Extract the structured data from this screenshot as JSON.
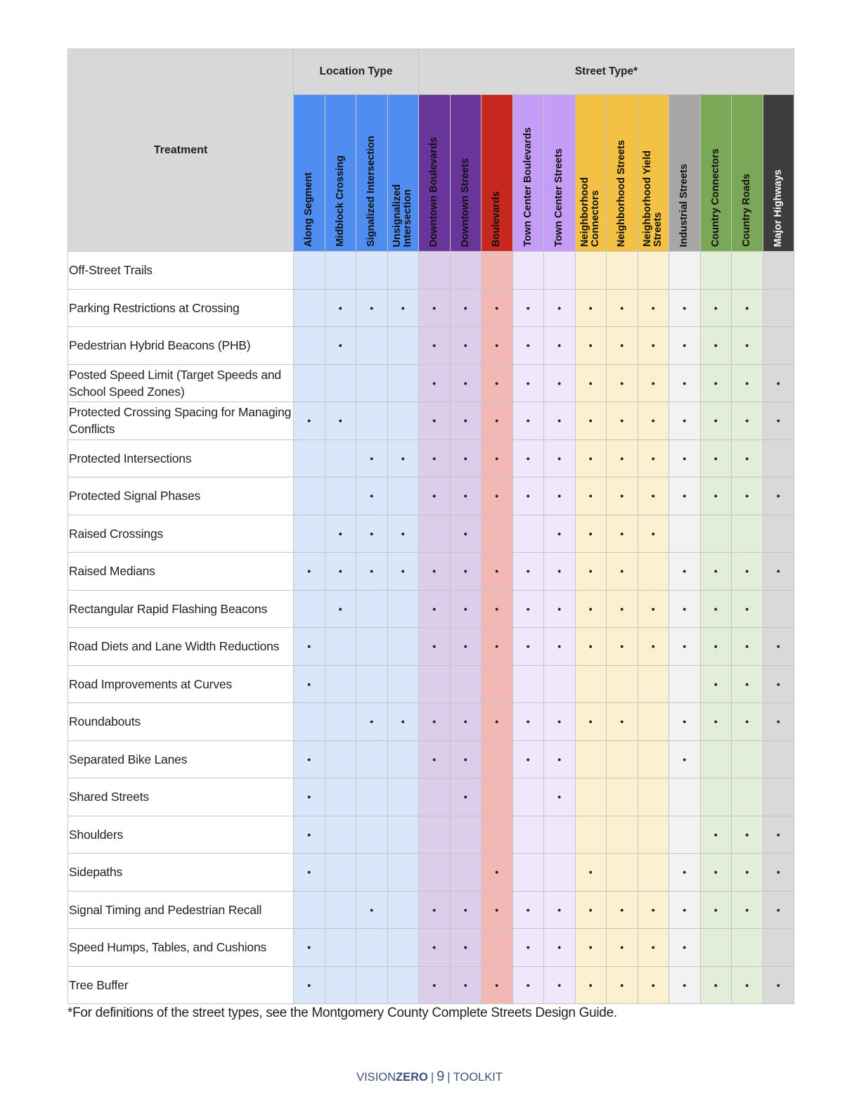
{
  "table": {
    "corner_label": "Treatment",
    "groups": [
      {
        "label": "Location Type",
        "span": 4
      },
      {
        "label": "Street Type*",
        "span": 12
      }
    ],
    "columns": [
      {
        "label": "Along Segment",
        "header_color": "#4f8ef0",
        "cell_color": "#d9e7fa",
        "text_color": "#111111"
      },
      {
        "label": "Midblock Crossing",
        "header_color": "#4f8ef0",
        "cell_color": "#d9e7fa",
        "text_color": "#111111"
      },
      {
        "label": "Signalized Intersection",
        "header_color": "#4f8ef0",
        "cell_color": "#d9e7fa",
        "text_color": "#111111"
      },
      {
        "label": "Unsignalized\nIntersection",
        "header_color": "#4f8ef0",
        "cell_color": "#d9e7fa",
        "text_color": "#111111"
      },
      {
        "label": "Downtown Boulevards",
        "header_color": "#6a359a",
        "cell_color": "#dccdea",
        "text_color": "#111111"
      },
      {
        "label": "Downtown Streets",
        "header_color": "#6a359a",
        "cell_color": "#dccdea",
        "text_color": "#111111"
      },
      {
        "label": "Boulevards",
        "header_color": "#c6281e",
        "cell_color": "#f2b8b6",
        "text_color": "#111111"
      },
      {
        "label": "Town Center Boulevards",
        "header_color": "#c59cf6",
        "cell_color": "#efe8fc",
        "text_color": "#111111"
      },
      {
        "label": "Town Center Streets",
        "header_color": "#c59cf6",
        "cell_color": "#efe8fc",
        "text_color": "#111111"
      },
      {
        "label": "Neighborhood\nConnectors",
        "header_color": "#f3c143",
        "cell_color": "#fbf0cf",
        "text_color": "#111111"
      },
      {
        "label": "Neighborhood Streets",
        "header_color": "#f3c143",
        "cell_color": "#fbf0cf",
        "text_color": "#111111"
      },
      {
        "label": "Neighborhood Yield\nStreets",
        "header_color": "#f3c143",
        "cell_color": "#fbf0cf",
        "text_color": "#111111"
      },
      {
        "label": "Industrial Streets",
        "header_color": "#a6a6a6",
        "cell_color": "#f2f2f2",
        "text_color": "#111111"
      },
      {
        "label": "Country Connectors",
        "header_color": "#79a856",
        "cell_color": "#e3eed9",
        "text_color": "#111111"
      },
      {
        "label": "Country Roads",
        "header_color": "#79a856",
        "cell_color": "#e3eed9",
        "text_color": "#111111"
      },
      {
        "label": "Major Highways",
        "header_color": "#3d3d3d",
        "cell_color": "#d9d9d9",
        "text_color": "#ffffff"
      }
    ],
    "mark_symbol": "•",
    "rows": [
      {
        "treatment": "Off-Street Trails",
        "marks": [
          0,
          0,
          0,
          0,
          0,
          0,
          0,
          0,
          0,
          0,
          0,
          0,
          0,
          0,
          0,
          0
        ]
      },
      {
        "treatment": "Parking Restrictions at Crossing",
        "marks": [
          0,
          1,
          1,
          1,
          1,
          1,
          1,
          1,
          1,
          1,
          1,
          1,
          1,
          1,
          1,
          0
        ]
      },
      {
        "treatment": "Pedestrian Hybrid Beacons (PHB)",
        "marks": [
          0,
          1,
          0,
          0,
          1,
          1,
          1,
          1,
          1,
          1,
          1,
          1,
          1,
          1,
          1,
          0
        ]
      },
      {
        "treatment": "Posted Speed Limit (Target Speeds and School Speed Zones)",
        "marks": [
          0,
          0,
          0,
          0,
          1,
          1,
          1,
          1,
          1,
          1,
          1,
          1,
          1,
          1,
          1,
          1
        ]
      },
      {
        "treatment": "Protected Crossing Spacing for Managing Conflicts",
        "marks": [
          1,
          1,
          0,
          0,
          1,
          1,
          1,
          1,
          1,
          1,
          1,
          1,
          1,
          1,
          1,
          1
        ]
      },
      {
        "treatment": "Protected Intersections",
        "marks": [
          0,
          0,
          1,
          1,
          1,
          1,
          1,
          1,
          1,
          1,
          1,
          1,
          1,
          1,
          1,
          0
        ]
      },
      {
        "treatment": "Protected Signal Phases",
        "marks": [
          0,
          0,
          1,
          0,
          1,
          1,
          1,
          1,
          1,
          1,
          1,
          1,
          1,
          1,
          1,
          1
        ]
      },
      {
        "treatment": "Raised Crossings",
        "marks": [
          0,
          1,
          1,
          1,
          0,
          1,
          0,
          0,
          1,
          1,
          1,
          1,
          0,
          0,
          0,
          0
        ]
      },
      {
        "treatment": "Raised Medians",
        "marks": [
          1,
          1,
          1,
          1,
          1,
          1,
          1,
          1,
          1,
          1,
          1,
          0,
          1,
          1,
          1,
          1
        ]
      },
      {
        "treatment": "Rectangular Rapid Flashing Beacons",
        "marks": [
          0,
          1,
          0,
          0,
          1,
          1,
          1,
          1,
          1,
          1,
          1,
          1,
          1,
          1,
          1,
          0
        ]
      },
      {
        "treatment": "Road Diets and Lane Width Reductions",
        "marks": [
          1,
          0,
          0,
          0,
          1,
          1,
          1,
          1,
          1,
          1,
          1,
          1,
          1,
          1,
          1,
          1
        ]
      },
      {
        "treatment": "Road Improvements at Curves",
        "marks": [
          1,
          0,
          0,
          0,
          0,
          0,
          0,
          0,
          0,
          0,
          0,
          0,
          0,
          1,
          1,
          1
        ]
      },
      {
        "treatment": "Roundabouts",
        "marks": [
          0,
          0,
          1,
          1,
          1,
          1,
          1,
          1,
          1,
          1,
          1,
          0,
          1,
          1,
          1,
          1
        ]
      },
      {
        "treatment": "Separated Bike Lanes",
        "marks": [
          1,
          0,
          0,
          0,
          1,
          1,
          0,
          1,
          1,
          0,
          0,
          0,
          1,
          0,
          0,
          0
        ]
      },
      {
        "treatment": "Shared Streets",
        "marks": [
          1,
          0,
          0,
          0,
          0,
          1,
          0,
          0,
          1,
          0,
          0,
          0,
          0,
          0,
          0,
          0
        ]
      },
      {
        "treatment": "Shoulders",
        "marks": [
          1,
          0,
          0,
          0,
          0,
          0,
          0,
          0,
          0,
          0,
          0,
          0,
          0,
          1,
          1,
          1
        ]
      },
      {
        "treatment": "Sidepaths",
        "marks": [
          1,
          0,
          0,
          0,
          0,
          0,
          1,
          0,
          0,
          1,
          0,
          0,
          1,
          1,
          1,
          1
        ]
      },
      {
        "treatment": "Signal Timing and Pedestrian Recall",
        "marks": [
          0,
          0,
          1,
          0,
          1,
          1,
          1,
          1,
          1,
          1,
          1,
          1,
          1,
          1,
          1,
          1
        ]
      },
      {
        "treatment": "Speed Humps, Tables, and Cushions",
        "marks": [
          1,
          0,
          0,
          0,
          1,
          1,
          0,
          1,
          1,
          1,
          1,
          1,
          1,
          0,
          0,
          0
        ]
      },
      {
        "treatment": "Tree Buffer",
        "marks": [
          1,
          0,
          0,
          0,
          1,
          1,
          1,
          1,
          1,
          1,
          1,
          1,
          1,
          1,
          1,
          1
        ]
      }
    ]
  },
  "footnote": "*For definitions of the street types, see the Montgomery County Complete Streets Design Guide.",
  "footer": {
    "brand_light": "VISION",
    "brand_bold": "ZERO",
    "page_number": "9",
    "section": "TOOLKIT"
  }
}
